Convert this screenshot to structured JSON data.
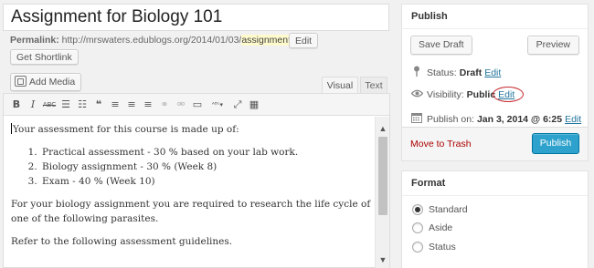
{
  "post": {
    "title": "Assignment for Biology 101",
    "permalink_label": "Permalink:",
    "permalink_base": "http://mrswaters.edublogs.org/2014/01/03/",
    "permalink_slug": "assignment",
    "permalink_end": "/",
    "edit_slug_label": "Edit",
    "get_shortlink_label": "Get Shortlink"
  },
  "editor": {
    "add_media_label": "Add Media",
    "tabs": [
      "Visual",
      "Text"
    ],
    "toolbar_icons": [
      "bold-icon",
      "italic-icon",
      "strikethrough-icon",
      "bullet-list-icon",
      "numbered-list-icon",
      "blockquote-icon",
      "align-left-icon",
      "align-center-icon",
      "align-right-icon",
      "link-icon",
      "unlink-icon",
      "more-tag-icon",
      "spellcheck-icon",
      "fullscreen-icon",
      "kitchen-sink-icon"
    ],
    "toolbar_glyphs": [
      "B",
      "I",
      "ABC",
      "☰",
      "☷",
      "❝",
      "≡",
      "≡",
      "≡",
      "⚭",
      "⚮",
      "▭",
      "ᴬᴮᶜ▾",
      "⤢",
      "▦"
    ],
    "paragraph1": "Your assessment for this course is made up of:",
    "list": [
      "Practical assessment - 30 % based on your lab work.",
      "Biology assignment - 30 % (Week 8)",
      "Exam - 40 % (Week 10)"
    ],
    "paragraph2": "For your biology assignment you are required to research the life cycle of one of the following parasites.",
    "paragraph3": "Refer to the following assessment guidelines."
  },
  "publish": {
    "heading": "Publish",
    "save_draft_label": "Save Draft",
    "preview_label": "Preview",
    "status_label": "Status:",
    "status_value": "Draft",
    "status_edit": "Edit",
    "visibility_label": "Visibility:",
    "visibility_value": "Public",
    "visibility_edit": "Edit",
    "publish_on_label": "Publish on:",
    "publish_on_value": "Jan 3, 2014 @ 6:25",
    "publish_on_edit": "Edit",
    "trash_label": "Move to Trash",
    "publish_label": "Publish"
  },
  "format": {
    "heading": "Format",
    "options": [
      "Standard",
      "Aside",
      "Status"
    ],
    "selected": "Standard"
  },
  "colors": {
    "primary_button": "#2ea2cc",
    "link": "#21759b",
    "trash": "#aa0000",
    "highlight_circle": "#c4282d"
  }
}
